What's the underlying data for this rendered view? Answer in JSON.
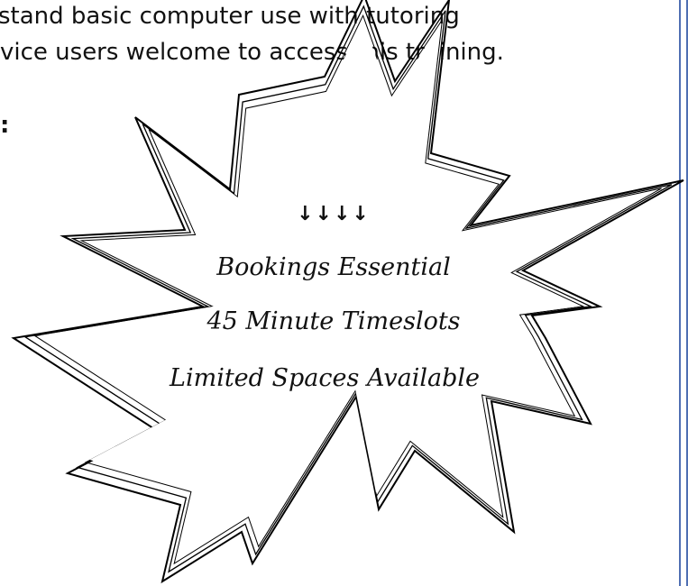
{
  "document": {
    "line_1": "stand basic computer use with tutoring",
    "line_2": "vice users welcome to access this training.",
    "label_colon": ":"
  },
  "callout": {
    "arrows": "↓↓↓↓",
    "line_1": "Bookings Essential",
    "line_2": "45 Minute Timeslots",
    "line_3": "Limited Spaces Available"
  },
  "colors": {
    "page_border": "#4f6fb3",
    "text": "#111111"
  }
}
